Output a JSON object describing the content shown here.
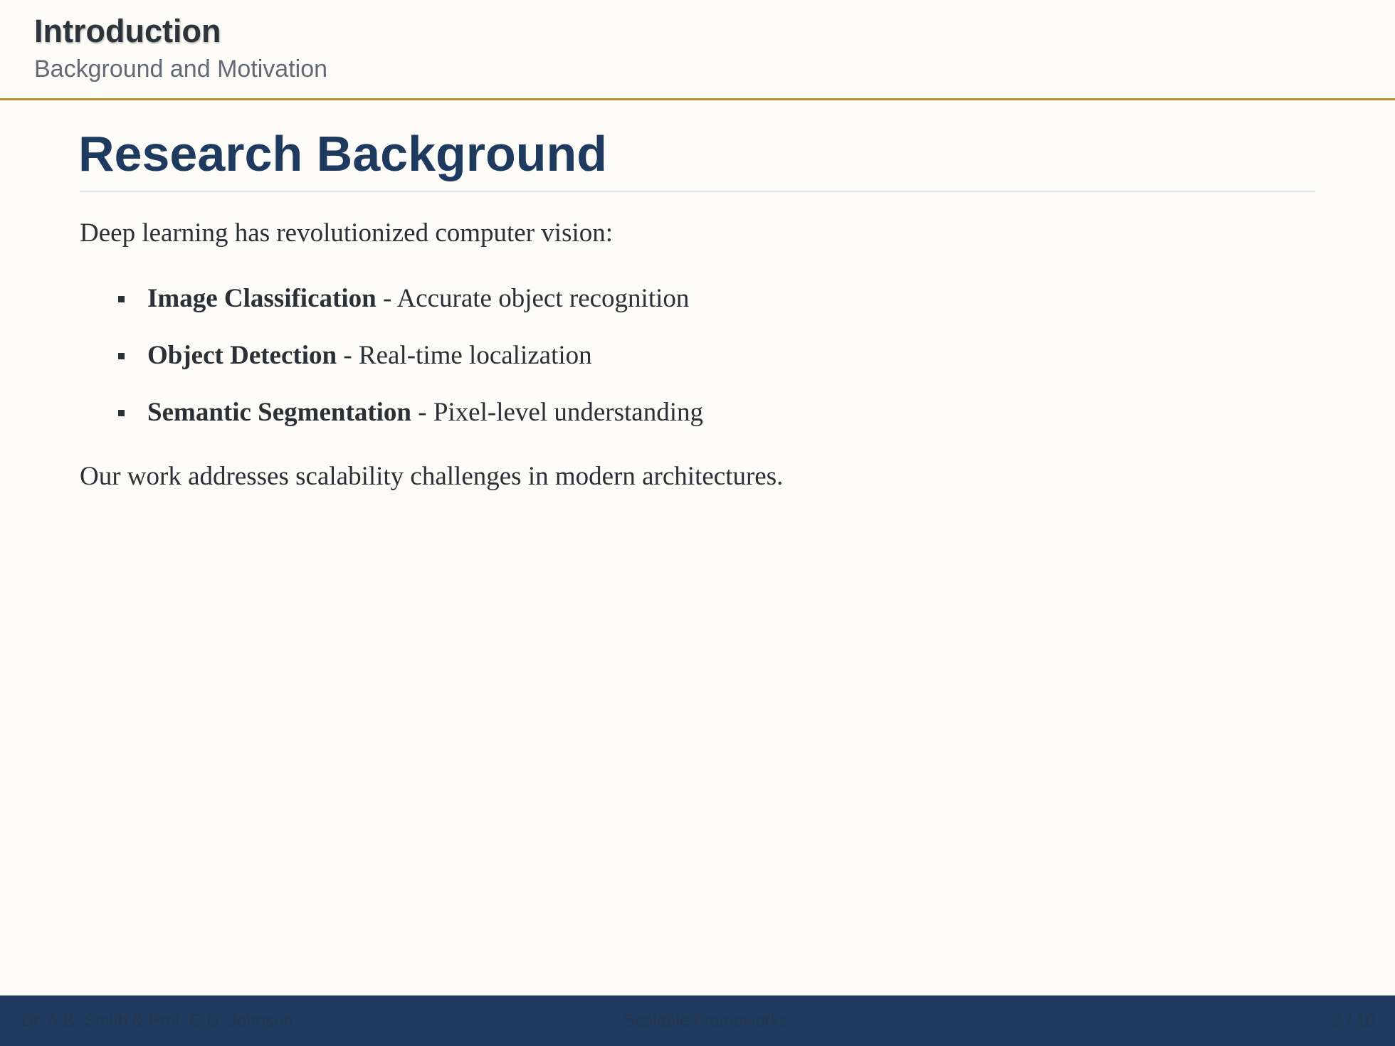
{
  "header": {
    "section_title": "Introduction",
    "section_subtitle": "Background and Motivation"
  },
  "frame": {
    "title": "Research Background",
    "intro": "Deep learning has revolutionized computer vision:",
    "bullets": [
      {
        "term": "Image Classification",
        "desc": " - Accurate object recognition"
      },
      {
        "term": "Object Detection",
        "desc": " - Real-time localization"
      },
      {
        "term": "Semantic Segmentation",
        "desc": " - Pixel-level understanding"
      }
    ],
    "conclusion": "Our work addresses scalability challenges in modern architectures."
  },
  "footer": {
    "authors": "Dr. A.B. Smith & Prof. C.D. Johnson",
    "center": "Scalable Frameworks",
    "page": "2 / 10"
  },
  "colors": {
    "background": "#fcfbf7",
    "accent_rule": "#b8912a",
    "title": "#1e3a5f",
    "footer_bar": "#1e3a5f"
  }
}
